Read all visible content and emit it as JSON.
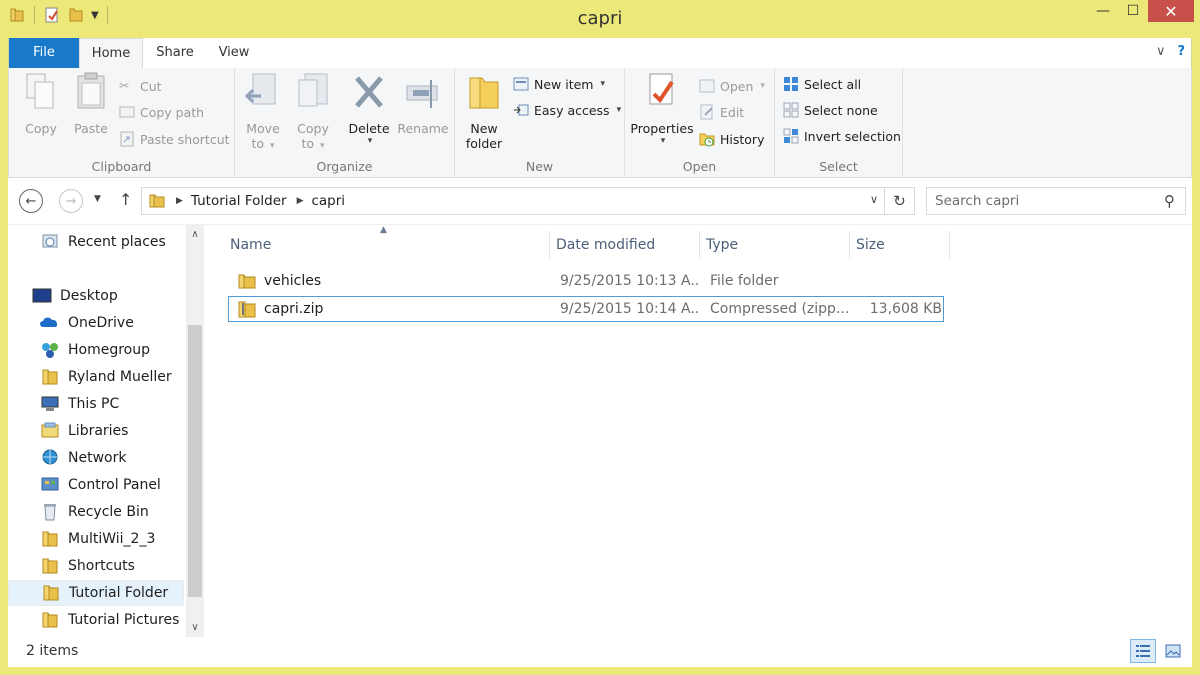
{
  "window": {
    "title": "capri",
    "controls": {
      "minimize": "—",
      "maximize": "☐",
      "close": "✕"
    }
  },
  "ribbon_tabs": [
    {
      "label": "File"
    },
    {
      "label": "Home"
    },
    {
      "label": "Share"
    },
    {
      "label": "View"
    }
  ],
  "ribbon": {
    "clipboard": {
      "label": "Clipboard",
      "copy": "Copy",
      "paste": "Paste",
      "cut": "Cut",
      "copy_path": "Copy path",
      "paste_shortcut": "Paste shortcut"
    },
    "organize": {
      "label": "Organize",
      "move_to_1": "Move",
      "move_to_2": "to",
      "copy_to_1": "Copy",
      "copy_to_2": "to",
      "delete": "Delete",
      "rename": "Rename"
    },
    "new": {
      "label": "New",
      "new_folder_1": "New",
      "new_folder_2": "folder",
      "new_item": "New item",
      "easy_access": "Easy access"
    },
    "open": {
      "label": "Open",
      "properties": "Properties",
      "open": "Open",
      "edit": "Edit",
      "history": "History"
    },
    "select": {
      "label": "Select",
      "select_all": "Select all",
      "select_none": "Select none",
      "invert_selection": "Invert selection"
    }
  },
  "address": {
    "crumbs": [
      "Tutorial Folder",
      "capri"
    ]
  },
  "search": {
    "placeholder": "Search capri"
  },
  "nav_pane": [
    {
      "label": "Recent places",
      "icon": "recent-places-icon"
    },
    {
      "label": "Desktop",
      "icon": "desktop-icon"
    },
    {
      "label": "OneDrive",
      "icon": "onedrive-icon"
    },
    {
      "label": "Homegroup",
      "icon": "homegroup-icon"
    },
    {
      "label": "Ryland Mueller",
      "icon": "user-folder-icon"
    },
    {
      "label": "This PC",
      "icon": "computer-icon"
    },
    {
      "label": "Libraries",
      "icon": "libraries-icon"
    },
    {
      "label": "Network",
      "icon": "network-icon"
    },
    {
      "label": "Control Panel",
      "icon": "control-panel-icon"
    },
    {
      "label": "Recycle Bin",
      "icon": "recycle-bin-icon"
    },
    {
      "label": "MultiWii_2_3",
      "icon": "folder-icon"
    },
    {
      "label": "Shortcuts",
      "icon": "folder-icon"
    },
    {
      "label": "Tutorial Folder",
      "icon": "folder-icon",
      "selected": true
    },
    {
      "label": "Tutorial Pictures",
      "icon": "folder-icon"
    }
  ],
  "columns": [
    {
      "label": "Name"
    },
    {
      "label": "Date modified"
    },
    {
      "label": "Type"
    },
    {
      "label": "Size"
    }
  ],
  "files": [
    {
      "name": "vehicles",
      "date": "9/25/2015 10:13 A...",
      "type": "File folder",
      "size": "",
      "icon": "folder-icon"
    },
    {
      "name": "capri.zip",
      "date": "9/25/2015 10:14 A...",
      "type": "Compressed (zipp...",
      "size": "13,608 KB",
      "icon": "zip-folder-icon",
      "selected": true
    }
  ],
  "status": {
    "count": "2 items"
  },
  "colors": {
    "accent": "#1979ca",
    "window_frame": "#ece97a",
    "close_button": "#c7504a",
    "selection_border": "#4f9bd6"
  }
}
